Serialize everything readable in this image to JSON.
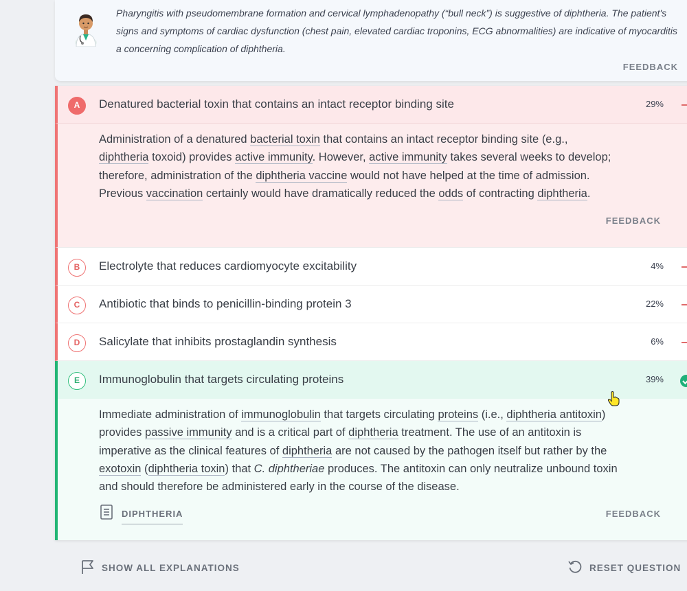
{
  "hint": {
    "line1": "Pharyngitis with pseudomembrane formation and cervical lymphadenopathy (“bull neck”) is suggestive of diphtheria. The patient's",
    "line2": "signs and symptoms of cardiac dysfunction (chest pain, elevated cardiac troponins, ECG abnormalities) are indicative of myocarditis",
    "line3": "a concerning complication of diphtheria.",
    "feedback_label": "FEEDBACK"
  },
  "options": [
    {
      "letter": "A",
      "text": "Denatured bacterial toxin that contains an intact receptor binding site",
      "percent": "29%",
      "state": "selected-wrong"
    },
    {
      "letter": "B",
      "text": "Electrolyte that reduces cardiomyocyte excitability",
      "percent": "4%",
      "state": "wrong"
    },
    {
      "letter": "C",
      "text": "Antibiotic that binds to penicillin-binding protein 3",
      "percent": "22%",
      "state": "wrong"
    },
    {
      "letter": "D",
      "text": "Salicylate that inhibits prostaglandin synthesis",
      "percent": "6%",
      "state": "wrong"
    },
    {
      "letter": "E",
      "text": "Immunoglobulin that targets circulating proteins",
      "percent": "39%",
      "state": "correct"
    }
  ],
  "explanation_a": {
    "t1": "Administration of a denatured ",
    "u1": "bacterial toxin",
    "t2": " that contains an intact receptor binding site (e.g.,",
    "u2": "diphtheria",
    "t3": " toxoid) provides ",
    "u3": "active immunity",
    "t4": ". However, ",
    "u4": "active immunity",
    "t5": " takes several weeks to develop;",
    "t6": "therefore, administration of the ",
    "u5": "diphtheria vaccine",
    "t7": " would not have helped at the time of admission.",
    "t8": "Previous ",
    "u6": "vaccination",
    "t9": " certainly would have dramatically reduced the ",
    "u7": "odds",
    "t10": " of contracting ",
    "u8": "diphtheria",
    "t11": ".",
    "feedback_label": "FEEDBACK"
  },
  "explanation_e": {
    "t1": "Immediate administration of ",
    "u1": "immunoglobulin",
    "t2": " that targets circulating ",
    "u2": "proteins",
    "t3": " (i.e., ",
    "u3": "diphtheria antitoxin",
    "t4": ")",
    "t5": "provides ",
    "u4": "passive immunity",
    "t6": " and is a critical part of ",
    "u5": "diphtheria",
    "t7": " treatment. The use of an antitoxin is",
    "t8": "imperative as the clinical features of ",
    "u6": "diphtheria",
    "t9": " are not caused by the pathogen itself but rather by the",
    "u7": "exotoxin",
    "t10": " (",
    "u8": "diphtheria toxin",
    "t11": ") that ",
    "i1": "C. diphtheriae",
    "t12": " produces. The antitoxin can only neutralize unbound toxin",
    "t13": "and should therefore be administered early in the course of the disease.",
    "article_label": "DIPHTHERIA",
    "feedback_label": "FEEDBACK"
  },
  "footer": {
    "show_all_label": "SHOW ALL EXPLANATIONS",
    "reset_label": "RESET QUESTION"
  },
  "colors": {
    "wrong": "#ef7474",
    "correct": "#22b574",
    "selected_bg": "#fde8ea",
    "correct_bg": "#e3f8f0"
  },
  "icons": [
    "doctor-avatar-icon",
    "check-circle-icon",
    "article-icon",
    "flag-icon",
    "reset-icon",
    "hand-cursor-icon"
  ]
}
